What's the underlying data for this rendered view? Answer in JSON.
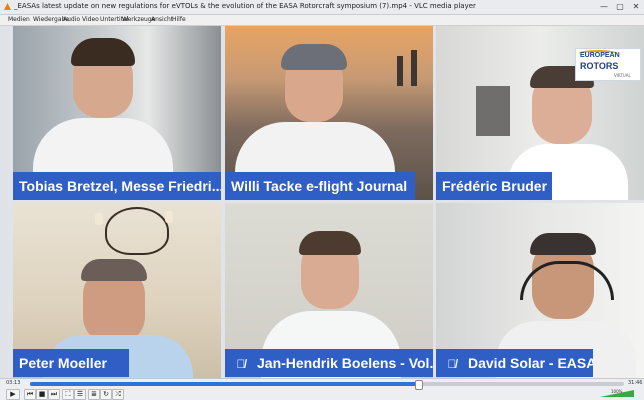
{
  "window": {
    "title": "_EASAs latest update on new regulations for eVTOLs & the evolution of the EASA Rotorcraft symposium (7).mp4 - VLC media player",
    "minimize": "—",
    "maximize": "▢",
    "close": "✕"
  },
  "menu": [
    "Medien",
    "Wiedergabe",
    "Audio",
    "Video",
    "Untertitel",
    "Werkzeuge",
    "Ansicht",
    "Hilfe"
  ],
  "participants": [
    {
      "name": "Tobias Bretzel, Messe Friedri...",
      "muted": false,
      "mic_icon": "mic-off-icon"
    },
    {
      "name": "Willi Tacke e-flight Journal",
      "muted": false,
      "mic_icon": "mic-off-icon"
    },
    {
      "name": "Frédéric Bruder",
      "muted": false,
      "mic_icon": "mic-off-icon"
    },
    {
      "name": "Peter Moeller",
      "muted": false,
      "mic_icon": "mic-off-icon"
    },
    {
      "name": "Jan-Hendrik Boelens - Vol...",
      "muted": true,
      "mic_icon": "mic-off-icon"
    },
    {
      "name": "David Solar - EASA",
      "muted": true,
      "mic_icon": "mic-off-icon"
    }
  ],
  "logo": {
    "line1": "EUROPEAN",
    "line2": "ROTORS",
    "line3": "VIRTUAL"
  },
  "player": {
    "elapsed": "03:13",
    "total": "31:46",
    "progress": 0.655,
    "volume": "100%",
    "buttons": {
      "play": "▶",
      "prev": "⏮",
      "stop": "■",
      "next": "⏭",
      "fullscreen": "⛶",
      "extended": "☰",
      "playlist": "≣",
      "loop": "↻",
      "random": "⤮"
    }
  },
  "colors": {
    "name_bar": "#2f5fc4",
    "seek": "#2d74d8"
  }
}
